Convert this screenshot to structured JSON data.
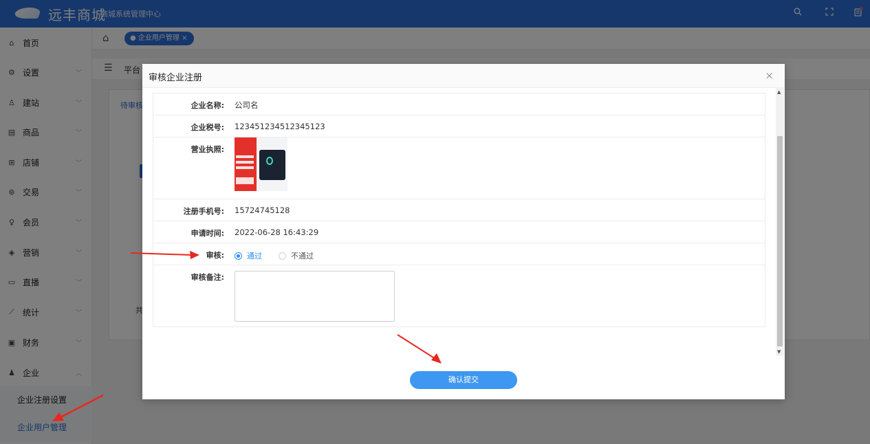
{
  "header": {
    "logo_text": "远丰商城",
    "system_title": "商城系统管理中心",
    "icons": [
      "search-icon",
      "fullscreen-icon",
      "notification-icon"
    ]
  },
  "sidebar": {
    "items": [
      {
        "label": "首页",
        "icon": "home-icon"
      },
      {
        "label": "设置",
        "icon": "gear-icon"
      },
      {
        "label": "建站",
        "icon": "site-icon"
      },
      {
        "label": "商品",
        "icon": "goods-icon"
      },
      {
        "label": "店铺",
        "icon": "store-icon"
      },
      {
        "label": "交易",
        "icon": "trade-icon"
      },
      {
        "label": "会员",
        "icon": "member-icon"
      },
      {
        "label": "营销",
        "icon": "marketing-icon"
      },
      {
        "label": "直播",
        "icon": "live-icon"
      },
      {
        "label": "统计",
        "icon": "stats-icon"
      },
      {
        "label": "财务",
        "icon": "finance-icon"
      },
      {
        "label": "企业",
        "icon": "enterprise-icon"
      }
    ],
    "sub_items": [
      {
        "label": "企业注册设置"
      },
      {
        "label": "企业用户管理"
      }
    ]
  },
  "content": {
    "tab_label": "企业用户管理",
    "crumb": "平台",
    "panel_tab": "待审核",
    "panel_total": "共"
  },
  "modal": {
    "title": "审核企业注册",
    "fields": {
      "company_name_label": "企业名称:",
      "company_name": "公司名",
      "tax_no_label": "企业税号:",
      "tax_no": "123451234512345123",
      "license_label": "营业执照:",
      "phone_label": "注册手机号:",
      "phone": "15724745128",
      "apply_time_label": "申请时间:",
      "apply_time": "2022-06-28 16:43:29",
      "audit_label": "审核:",
      "audit_pass": "通过",
      "audit_reject": "不通过",
      "remark_label": "审核备注:",
      "remark_value": ""
    },
    "submit_label": "确认提交"
  },
  "colors": {
    "header_bg": "#2d6fd6",
    "accent": "#2d8cf0",
    "submit": "#3e97f0",
    "annotation": "#e8281e"
  }
}
